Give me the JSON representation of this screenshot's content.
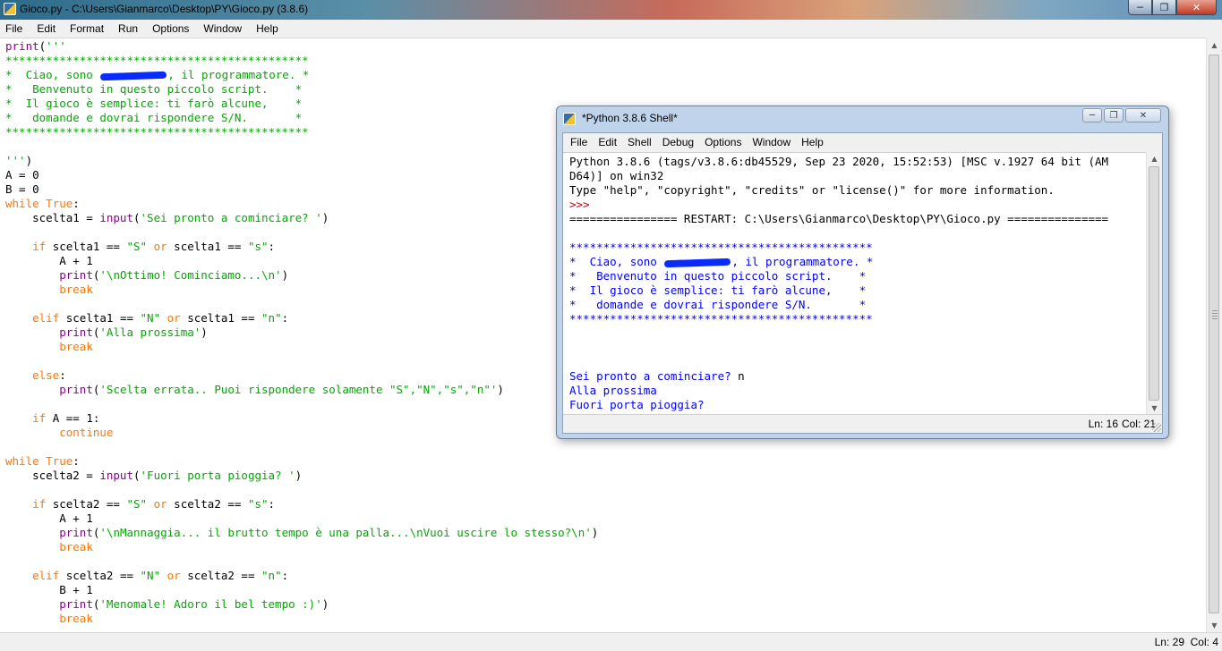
{
  "editor": {
    "title": "Gioco.py - C:\\Users\\Gianmarco\\Desktop\\PY\\Gioco.py (3.8.6)",
    "menu": [
      "File",
      "Edit",
      "Format",
      "Run",
      "Options",
      "Window",
      "Help"
    ],
    "status": {
      "ln": "Ln: 29",
      "col": "Col: 4"
    },
    "lines": [
      [
        {
          "t": "print",
          "c": "bi"
        },
        {
          "t": "(",
          "c": ""
        },
        {
          "t": "'''",
          "c": "st"
        }
      ],
      [
        {
          "t": "*********************************************",
          "c": "st"
        }
      ],
      [
        {
          "t": "*  Ciao, sono ",
          "c": "st"
        },
        {
          "t": "",
          "c": "redact"
        },
        {
          "t": ", il programmatore. *",
          "c": "st"
        }
      ],
      [
        {
          "t": "*   Benvenuto in questo piccolo script.    *",
          "c": "st"
        }
      ],
      [
        {
          "t": "*  Il gioco è semplice: ti farò alcune,    *",
          "c": "st"
        }
      ],
      [
        {
          "t": "*   domande e dovrai rispondere S/N.       *",
          "c": "st"
        }
      ],
      [
        {
          "t": "*********************************************",
          "c": "st"
        }
      ],
      [],
      [
        {
          "t": "'''",
          "c": "st"
        },
        {
          "t": ")",
          "c": ""
        }
      ],
      [
        {
          "t": "A = 0",
          "c": ""
        }
      ],
      [
        {
          "t": "B = 0",
          "c": ""
        }
      ],
      [
        {
          "t": "while",
          "c": "kw"
        },
        {
          "t": " ",
          "c": ""
        },
        {
          "t": "True",
          "c": "kw"
        },
        {
          "t": ":",
          "c": ""
        }
      ],
      [
        {
          "t": "    scelta1 = ",
          "c": ""
        },
        {
          "t": "input",
          "c": "bi"
        },
        {
          "t": "(",
          "c": ""
        },
        {
          "t": "'Sei pronto a cominciare? '",
          "c": "st"
        },
        {
          "t": ")",
          "c": ""
        }
      ],
      [],
      [
        {
          "t": "    ",
          "c": ""
        },
        {
          "t": "if",
          "c": "kw"
        },
        {
          "t": " scelta1 == ",
          "c": ""
        },
        {
          "t": "\"S\"",
          "c": "st"
        },
        {
          "t": " ",
          "c": ""
        },
        {
          "t": "or",
          "c": "kw"
        },
        {
          "t": " scelta1 == ",
          "c": ""
        },
        {
          "t": "\"s\"",
          "c": "st"
        },
        {
          "t": ":",
          "c": ""
        }
      ],
      [
        {
          "t": "        A + 1",
          "c": ""
        }
      ],
      [
        {
          "t": "        ",
          "c": ""
        },
        {
          "t": "print",
          "c": "bi"
        },
        {
          "t": "(",
          "c": ""
        },
        {
          "t": "'\\nOttimo! Cominciamo...\\n'",
          "c": "st"
        },
        {
          "t": ")",
          "c": ""
        }
      ],
      [
        {
          "t": "        ",
          "c": ""
        },
        {
          "t": "break",
          "c": "kw"
        }
      ],
      [],
      [
        {
          "t": "    ",
          "c": ""
        },
        {
          "t": "elif",
          "c": "kw"
        },
        {
          "t": " scelta1 == ",
          "c": ""
        },
        {
          "t": "\"N\"",
          "c": "st"
        },
        {
          "t": " ",
          "c": ""
        },
        {
          "t": "or",
          "c": "kw"
        },
        {
          "t": " scelta1 == ",
          "c": ""
        },
        {
          "t": "\"n\"",
          "c": "st"
        },
        {
          "t": ":",
          "c": ""
        }
      ],
      [
        {
          "t": "        ",
          "c": ""
        },
        {
          "t": "print",
          "c": "bi"
        },
        {
          "t": "(",
          "c": ""
        },
        {
          "t": "'Alla prossima'",
          "c": "st"
        },
        {
          "t": ")",
          "c": ""
        }
      ],
      [
        {
          "t": "        ",
          "c": ""
        },
        {
          "t": "break",
          "c": "kw"
        }
      ],
      [],
      [
        {
          "t": "    ",
          "c": ""
        },
        {
          "t": "else",
          "c": "kw"
        },
        {
          "t": ":",
          "c": ""
        }
      ],
      [
        {
          "t": "        ",
          "c": ""
        },
        {
          "t": "print",
          "c": "bi"
        },
        {
          "t": "(",
          "c": ""
        },
        {
          "t": "'Scelta errata.. Puoi rispondere solamente \"S\",\"N\",\"s\",\"n\"'",
          "c": "st"
        },
        {
          "t": ")",
          "c": ""
        }
      ],
      [],
      [
        {
          "t": "    ",
          "c": ""
        },
        {
          "t": "if",
          "c": "kw"
        },
        {
          "t": " A == 1:",
          "c": ""
        }
      ],
      [
        {
          "t": "        ",
          "c": ""
        },
        {
          "t": "continue",
          "c": "kw"
        }
      ],
      [],
      [
        {
          "t": "while",
          "c": "kw"
        },
        {
          "t": " ",
          "c": ""
        },
        {
          "t": "True",
          "c": "kw"
        },
        {
          "t": ":",
          "c": ""
        }
      ],
      [
        {
          "t": "    scelta2 = ",
          "c": ""
        },
        {
          "t": "input",
          "c": "bi"
        },
        {
          "t": "(",
          "c": ""
        },
        {
          "t": "'Fuori porta pioggia? '",
          "c": "st"
        },
        {
          "t": ")",
          "c": ""
        }
      ],
      [],
      [
        {
          "t": "    ",
          "c": ""
        },
        {
          "t": "if",
          "c": "kw"
        },
        {
          "t": " scelta2 == ",
          "c": ""
        },
        {
          "t": "\"S\"",
          "c": "st"
        },
        {
          "t": " ",
          "c": ""
        },
        {
          "t": "or",
          "c": "kw"
        },
        {
          "t": " scelta2 == ",
          "c": ""
        },
        {
          "t": "\"s\"",
          "c": "st"
        },
        {
          "t": ":",
          "c": ""
        }
      ],
      [
        {
          "t": "        A + 1",
          "c": ""
        }
      ],
      [
        {
          "t": "        ",
          "c": ""
        },
        {
          "t": "print",
          "c": "bi"
        },
        {
          "t": "(",
          "c": ""
        },
        {
          "t": "'\\nMannaggia... il brutto tempo è una palla...\\nVuoi uscire lo stesso?\\n'",
          "c": "st"
        },
        {
          "t": ")",
          "c": ""
        }
      ],
      [
        {
          "t": "        ",
          "c": ""
        },
        {
          "t": "break",
          "c": "kw"
        }
      ],
      [],
      [
        {
          "t": "    ",
          "c": ""
        },
        {
          "t": "elif",
          "c": "kw"
        },
        {
          "t": " scelta2 == ",
          "c": ""
        },
        {
          "t": "\"N\"",
          "c": "st"
        },
        {
          "t": " ",
          "c": ""
        },
        {
          "t": "or",
          "c": "kw"
        },
        {
          "t": " scelta2 == ",
          "c": ""
        },
        {
          "t": "\"n\"",
          "c": "st"
        },
        {
          "t": ":",
          "c": ""
        }
      ],
      [
        {
          "t": "        B + 1",
          "c": ""
        }
      ],
      [
        {
          "t": "        ",
          "c": ""
        },
        {
          "t": "print",
          "c": "bi"
        },
        {
          "t": "(",
          "c": ""
        },
        {
          "t": "'Menomale! Adoro il bel tempo :)'",
          "c": "st"
        },
        {
          "t": ")",
          "c": ""
        }
      ],
      [
        {
          "t": "        ",
          "c": ""
        },
        {
          "t": "break",
          "c": "kw"
        }
      ]
    ]
  },
  "shell": {
    "title": "*Python 3.8.6 Shell*",
    "menu": [
      "File",
      "Edit",
      "Shell",
      "Debug",
      "Options",
      "Window",
      "Help"
    ],
    "status": {
      "ln": "Ln: 16",
      "col": "Col: 21"
    },
    "lines": [
      [
        {
          "t": "Python 3.8.6 (tags/v3.8.6:db45529, Sep 23 2020, 15:52:53) [MSC v.1927 64 bit (AM",
          "c": ""
        }
      ],
      [
        {
          "t": "D64)] on win32",
          "c": ""
        }
      ],
      [
        {
          "t": "Type \"help\", \"copyright\", \"credits\" or \"license()\" for more information.",
          "c": ""
        }
      ],
      [
        {
          "t": ">>> ",
          "c": "red"
        }
      ],
      [
        {
          "t": "================ RESTART: C:\\Users\\Gianmarco\\Desktop\\PY\\Gioco.py ===============",
          "c": ""
        }
      ],
      [],
      [
        {
          "t": "*********************************************",
          "c": "blue"
        }
      ],
      [
        {
          "t": "*  Ciao, sono ",
          "c": "blue"
        },
        {
          "t": "",
          "c": "redact"
        },
        {
          "t": ", il programmatore. *",
          "c": "blue"
        }
      ],
      [
        {
          "t": "*   Benvenuto in questo piccolo script.    *",
          "c": "blue"
        }
      ],
      [
        {
          "t": "*  Il gioco è semplice: ti farò alcune,    *",
          "c": "blue"
        }
      ],
      [
        {
          "t": "*   domande e dovrai rispondere S/N.       *",
          "c": "blue"
        }
      ],
      [
        {
          "t": "*********************************************",
          "c": "blue"
        }
      ],
      [],
      [],
      [],
      [
        {
          "t": "Sei pronto a cominciare? ",
          "c": "blue"
        },
        {
          "t": "n",
          "c": ""
        }
      ],
      [
        {
          "t": "Alla prossima",
          "c": "blue"
        }
      ],
      [
        {
          "t": "Fuori porta pioggia? ",
          "c": "blue"
        }
      ]
    ]
  },
  "colors": {
    "keyword": "#ff7700",
    "string": "#00aa00",
    "builtin": "#900090",
    "shell_output": "#0000ff",
    "prompt": "#c00000",
    "redaction": "#0a2bff"
  }
}
